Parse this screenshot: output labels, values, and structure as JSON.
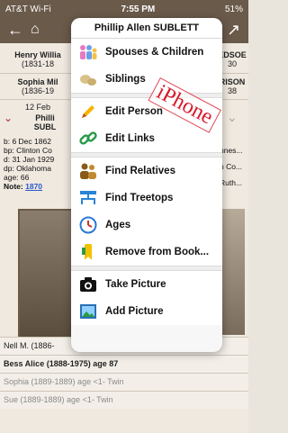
{
  "status": {
    "carrier": "AT&T Wi-Fi",
    "time": "7:55 PM",
    "battery": "51%"
  },
  "background": {
    "rows": [
      {
        "left": "Henry Willia",
        "left_sub": "(1831-18",
        "right": "EDSOE",
        "right_sub": "30"
      },
      {
        "left": "Sophia Mil",
        "left_sub": "(1836-19",
        "right": "RISON",
        "right_sub": "38"
      }
    ],
    "date_line": "12 Feb",
    "person_line": "Philli",
    "person_sub": "SUBL",
    "details": [
      "b: 6 Dec 1862",
      "bp: Clinton Co",
      "d: 31 Jan 1929",
      "dp: Oklahoma",
      "age: 66"
    ],
    "note_prefix": "Note:",
    "note_link": "1870",
    "right_details": [
      "nnes...",
      "n Co...",
      "Ruth..."
    ],
    "list": [
      {
        "text": "Nell M. (1886-",
        "style": "normal"
      },
      {
        "text": "Bess Alice (1888-1975) age 87",
        "style": "bold"
      },
      {
        "text": "Sophia (1889-1889) age <1- Twin",
        "style": "grey"
      },
      {
        "text": "Sue (1889-1889) age <1- Twin",
        "style": "grey"
      }
    ]
  },
  "popup": {
    "title": "Phillip Allen SUBLETT",
    "items": [
      {
        "label": "Spouses & Children",
        "icon": "family-icon"
      },
      {
        "label": "Siblings",
        "icon": "siblings-icon"
      },
      {
        "label": "Edit Person",
        "icon": "pencil-icon"
      },
      {
        "label": "Edit Links",
        "icon": "link-icon"
      },
      {
        "label": "Find Relatives",
        "icon": "relatives-icon"
      },
      {
        "label": "Find Treetops",
        "icon": "tree-icon"
      },
      {
        "label": "Ages",
        "icon": "clock-icon"
      },
      {
        "label": "Remove from Book...",
        "icon": "bookmark-icon"
      },
      {
        "label": "Take Picture",
        "icon": "camera-icon"
      },
      {
        "label": "Add Picture",
        "icon": "picture-icon"
      }
    ]
  },
  "watermark": "iPhone"
}
